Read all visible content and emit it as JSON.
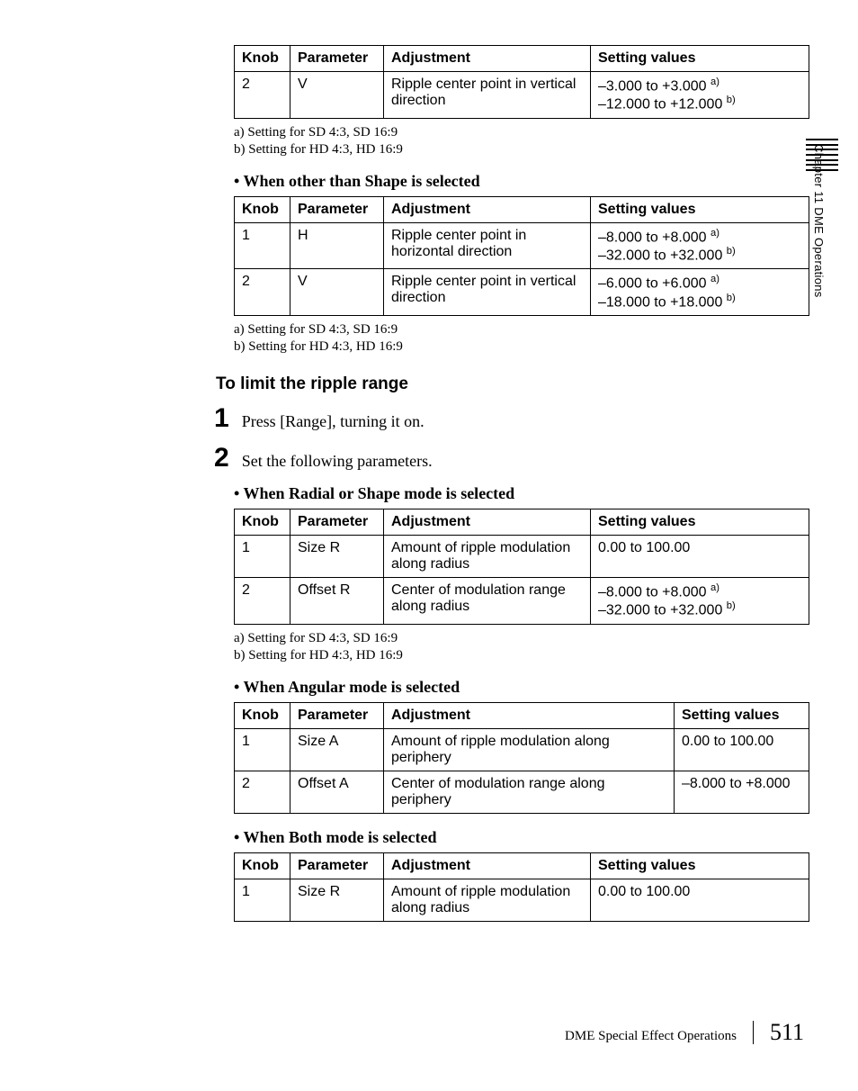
{
  "sideText": "Chapter 11  DME Operations",
  "tables": {
    "t1": {
      "headers": [
        "Knob",
        "Parameter",
        "Adjustment",
        "Setting values"
      ],
      "rows": [
        {
          "knob": "2",
          "param": "V",
          "adj": "Ripple center point in vertical direction",
          "sv1_pre": "–3.000 to +3.000 ",
          "sv1_sup": "a)",
          "sv2_pre": "–12.000 to +12.000 ",
          "sv2_sup": "b)"
        }
      ]
    },
    "t2": {
      "rows": [
        {
          "knob": "1",
          "param": "H",
          "adj": "Ripple center point in horizontal direction",
          "sv1_pre": "–8.000 to +8.000 ",
          "sv1_sup": "a)",
          "sv2_pre": "–32.000 to +32.000 ",
          "sv2_sup": "b)"
        },
        {
          "knob": "2",
          "param": "V",
          "adj": "Ripple center point in vertical direction",
          "sv1_pre": "–6.000 to +6.000 ",
          "sv1_sup": "a)",
          "sv2_pre": "–18.000 to +18.000 ",
          "sv2_sup": "b)"
        }
      ]
    },
    "t3": {
      "rows": [
        {
          "knob": "1",
          "param": "Size R",
          "adj": "Amount of ripple modulation along radius",
          "sv1": "0.00 to 100.00"
        },
        {
          "knob": "2",
          "param": "Offset R",
          "adj": "Center of modulation range along radius",
          "sv1_pre": "–8.000 to +8.000 ",
          "sv1_sup": "a)",
          "sv2_pre": "–32.000 to +32.000 ",
          "sv2_sup": "b)"
        }
      ]
    },
    "t4": {
      "rows": [
        {
          "knob": "1",
          "param": "Size A",
          "adj": "Amount of ripple modulation along periphery",
          "sv1": "0.00 to 100.00"
        },
        {
          "knob": "2",
          "param": "Offset A",
          "adj": "Center of modulation range along periphery",
          "sv1": "–8.000 to +8.000"
        }
      ]
    },
    "t5": {
      "rows": [
        {
          "knob": "1",
          "param": "Size R",
          "adj": "Amount of ripple modulation along radius",
          "sv1": "0.00 to 100.00"
        }
      ]
    }
  },
  "footnotes": {
    "a": "a) Setting for SD 4:3, SD 16:9",
    "b": "b) Setting for HD 4:3, HD 16:9"
  },
  "headings": {
    "otherThanShape": "When other than Shape is selected",
    "limitRipple": "To limit the ripple range",
    "radialShape": "When Radial or Shape mode is selected",
    "angular": "When Angular mode is selected",
    "both": "When Both mode is selected"
  },
  "steps": {
    "s1num": "1",
    "s1text": "Press [Range], turning it on.",
    "s2num": "2",
    "s2text": "Set the following parameters."
  },
  "footer": {
    "title": "DME Special Effect Operations",
    "page": "511"
  }
}
